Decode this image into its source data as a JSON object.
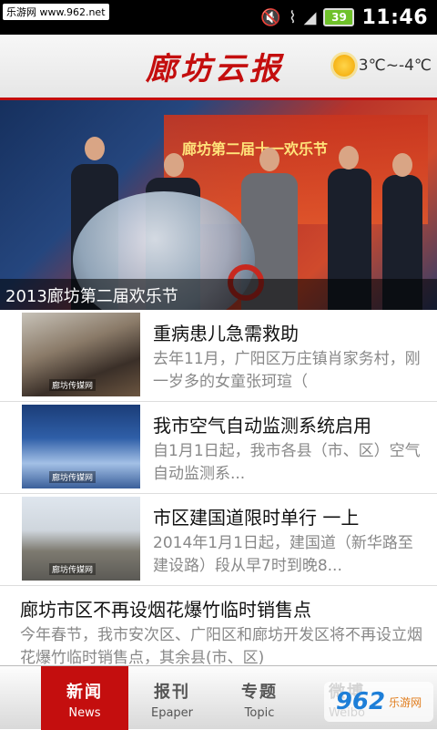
{
  "statusbar": {
    "watermark": "乐游网 www.962.net",
    "battery": "39",
    "time": "11:46",
    "icons": [
      "mute-icon",
      "wifi-icon",
      "signal-icon",
      "battery-icon"
    ]
  },
  "header": {
    "logo": "廊坊云报",
    "temperature": "3℃~-4℃",
    "weather_icon": "sun-icon"
  },
  "hero": {
    "banner_text": "廊坊第二届十一欢乐节",
    "caption": "2013廊坊第二届欢乐节"
  },
  "news": [
    {
      "title": "重病患儿急需救助",
      "desc": "去年11月，广阳区万庄镇肖家务村，刚一岁多的女童张珂瑄（",
      "thumb_mark": "廊坊传媒网"
    },
    {
      "title": "我市空气自动监测系统启用",
      "desc": "自1月1日起，我市各县（市、区）空气自动监测系...",
      "thumb_mark": "廊坊传媒网"
    },
    {
      "title": "市区建国道限时单行 一上",
      "desc": "2014年1月1日起，建国道（新华路至建设路）段从早7时到晚8...",
      "thumb_mark": "廊坊传媒网"
    }
  ],
  "wide_news": {
    "title": "廊坊市区不再设烟花爆竹临时销售点",
    "desc": "今年春节，我市安次区、广阳区和廊坊开发区将不再设立烟花爆竹临时销售点，其余县(市、区)"
  },
  "tabs": [
    {
      "cn": "新闻",
      "en": "News"
    },
    {
      "cn": "报刊",
      "en": "Epaper"
    },
    {
      "cn": "专题",
      "en": "Topic"
    },
    {
      "cn": "微博",
      "en": "Weibo"
    }
  ],
  "watermark_bottom": {
    "main": "962",
    "sub": "乐游网"
  },
  "colors": {
    "accent": "#c40e0e"
  }
}
